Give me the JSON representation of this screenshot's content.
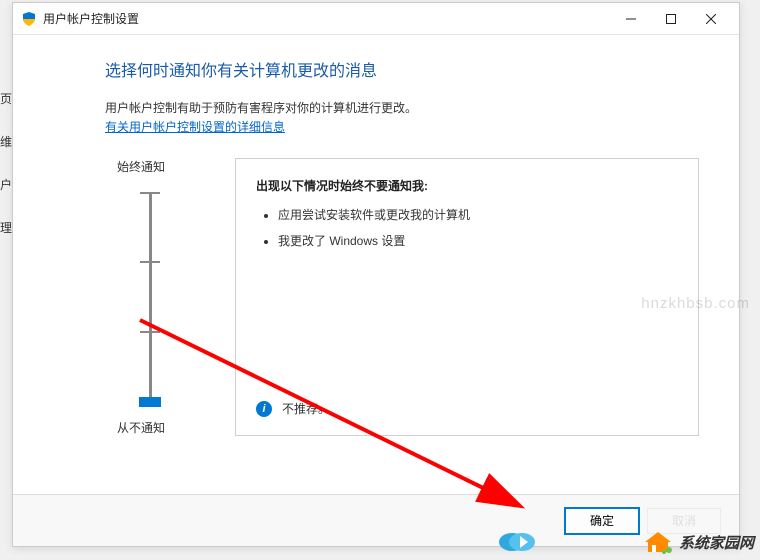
{
  "window": {
    "title": "用户帐户控制设置"
  },
  "heading": "选择何时通知你有关计算机更改的消息",
  "description": "用户帐户控制有助于预防有害程序对你的计算机进行更改。",
  "link_text": "有关用户帐户控制设置的详细信息",
  "slider": {
    "top_label": "始终通知",
    "bottom_label": "从不通知"
  },
  "info": {
    "title": "出现以下情况时始终不要通知我:",
    "items": [
      "应用尝试安装软件或更改我的计算机",
      "我更改了 Windows 设置"
    ],
    "footer": "不推荐。"
  },
  "buttons": {
    "ok": "确定",
    "cancel": "取消"
  },
  "left_strip": {
    "a": "页",
    "b": "维",
    "c": "户",
    "d": "理"
  },
  "brand": "系统家园网",
  "watermark": "hnzkhbsb.com"
}
